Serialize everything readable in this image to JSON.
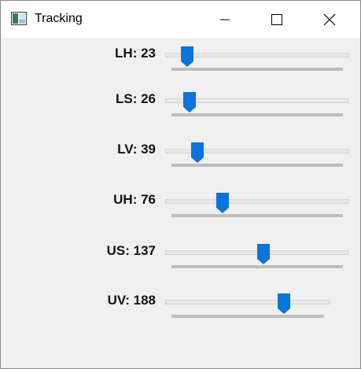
{
  "window": {
    "title": "Tracking",
    "buttons": {
      "minimize_icon": "minimize-icon",
      "maximize_icon": "maximize-icon",
      "close_icon": "close-icon"
    }
  },
  "colors": {
    "thumb": "#0a74da",
    "channel": "#e7e7e7",
    "baseline": "#bdbdbd",
    "window_bg": "#f0f0f0"
  },
  "trackbars": [
    {
      "label": "LH: 23",
      "name": "LH",
      "value": 23
    },
    {
      "label": "LS: 26",
      "name": "LS",
      "value": 26
    },
    {
      "label": "LV: 39",
      "name": "LV",
      "value": 39
    },
    {
      "label": "UH: 76",
      "name": "UH",
      "value": 76
    },
    {
      "label": "US: 137",
      "name": "US",
      "value": 137
    },
    {
      "label": "UV: 188",
      "name": "UV",
      "value": 188
    }
  ]
}
